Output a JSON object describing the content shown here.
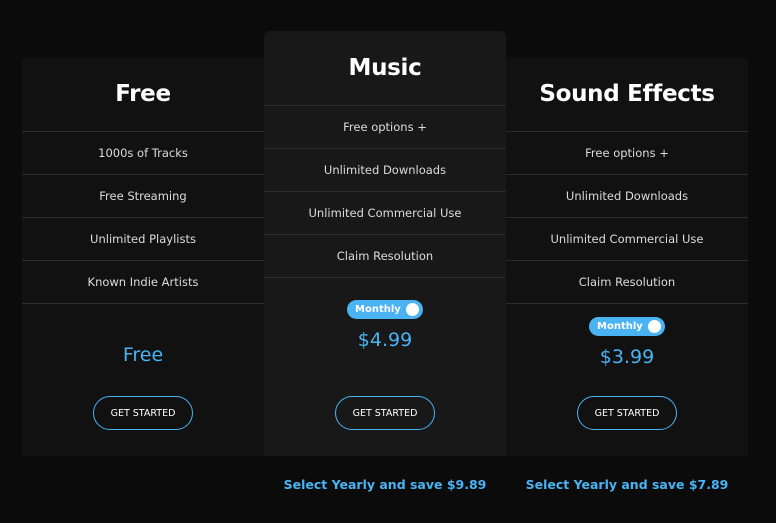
{
  "colors": {
    "accent": "#4ab3f4",
    "background": "#0b0b0b",
    "card": "#111111",
    "card_featured": "#181818"
  },
  "plans": [
    {
      "name": "Free",
      "features": [
        "1000s of Tracks",
        "Free Streaming",
        "Unlimited Playlists",
        "Known Indie Artists"
      ],
      "price": "Free",
      "button_label": "GET STARTED"
    },
    {
      "name": "Music",
      "features": [
        "Free options +",
        "Unlimited Downloads",
        "Unlimited Commercial Use",
        "Claim Resolution"
      ],
      "billing_toggle": {
        "label": "Monthly",
        "on": true
      },
      "price": "$4.99",
      "button_label": "GET STARTED",
      "savings_text": "Select Yearly and save $9.89"
    },
    {
      "name": "Sound Effects",
      "features": [
        "Free options +",
        "Unlimited Downloads",
        "Unlimited Commercial Use",
        "Claim Resolution"
      ],
      "billing_toggle": {
        "label": "Monthly",
        "on": true
      },
      "price": "$3.99",
      "button_label": "GET STARTED",
      "savings_text": "Select Yearly and save $7.89"
    }
  ]
}
